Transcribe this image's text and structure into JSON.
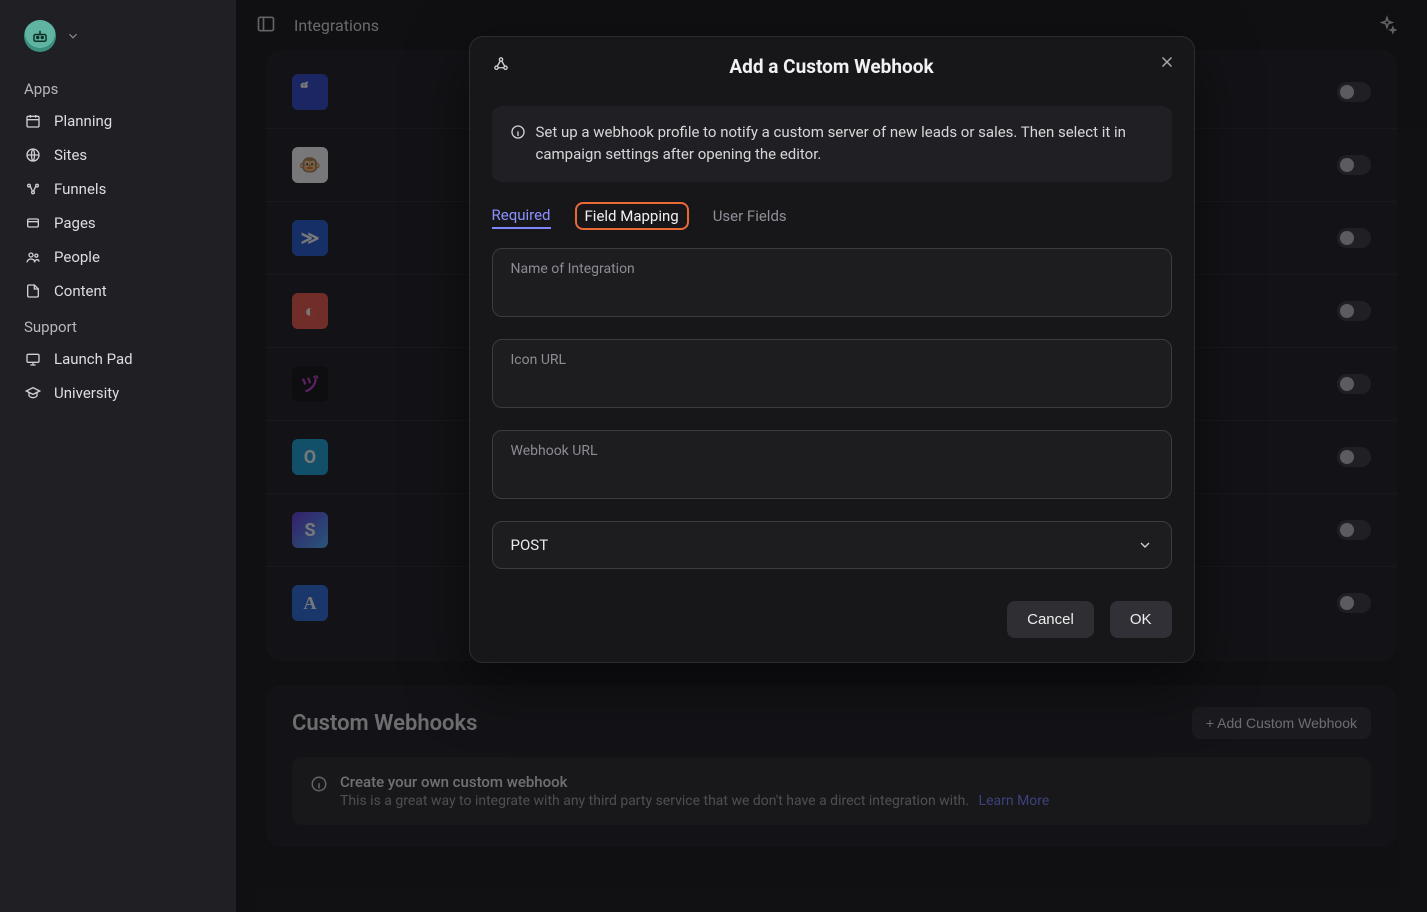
{
  "header": {
    "page_title": "Integrations"
  },
  "sidebar": {
    "apps_label": "Apps",
    "support_label": "Support",
    "apps": [
      {
        "label": "Planning",
        "icon": "calendar-icon"
      },
      {
        "label": "Sites",
        "icon": "globe-icon"
      },
      {
        "label": "Funnels",
        "icon": "funnel-icon"
      },
      {
        "label": "Pages",
        "icon": "page-icon"
      },
      {
        "label": "People",
        "icon": "people-icon"
      },
      {
        "label": "Content",
        "icon": "content-icon"
      }
    ],
    "support": [
      {
        "label": "Launch Pad",
        "icon": "launch-icon"
      },
      {
        "label": "University",
        "icon": "grad-icon"
      }
    ]
  },
  "integrations_visible": [
    {
      "name": "",
      "logo_bg": "#3349c9",
      "logo_text": "็",
      "enabled": false
    },
    {
      "name": "",
      "logo_bg": "#ffffff",
      "logo_text": "🐵",
      "logo_color": "#2b2b2b",
      "enabled": false
    },
    {
      "name": "",
      "logo_bg": "#265fd6",
      "logo_text": "≫",
      "enabled": false
    },
    {
      "name": "",
      "logo_bg": "#ef5a4a",
      "logo_text": "◐",
      "enabled": false
    },
    {
      "name": "",
      "logo_bg": "#141416",
      "logo_text": "ヅ",
      "logo_color": "#c246c9",
      "enabled": false
    },
    {
      "name": "",
      "logo_bg": "#1ea5d8",
      "logo_text": "O",
      "enabled": false
    },
    {
      "name": "",
      "logo_bg": "linear-gradient(135deg,#6a3bdc,#4fb6ff)",
      "logo_text": "S",
      "enabled": false
    },
    {
      "name": "",
      "logo_bg": "#2f6fe0",
      "logo_text": "A",
      "logo_font": "serif",
      "enabled": false
    }
  ],
  "custom_section": {
    "title": "Custom Webhooks",
    "add_button": "+ Add Custom Webhook",
    "info_title": "Create your own custom webhook",
    "info_sub": "This is a great way to integrate with any third party service that we don't have a direct integration with.",
    "learn_more": "Learn More"
  },
  "modal": {
    "title": "Add a Custom Webhook",
    "callout": "Set up a webhook profile to notify a custom server of new leads or sales. Then select it in campaign settings after opening the editor.",
    "tabs": [
      {
        "label": "Required",
        "state": "active"
      },
      {
        "label": "Field Mapping",
        "state": "highlight"
      },
      {
        "label": "User Fields",
        "state": ""
      }
    ],
    "fields": {
      "name_label": "Name of Integration",
      "icon_url_label": "Icon URL",
      "webhook_url_label": "Webhook URL",
      "method_value": "POST"
    },
    "buttons": {
      "cancel": "Cancel",
      "ok": "OK"
    }
  }
}
